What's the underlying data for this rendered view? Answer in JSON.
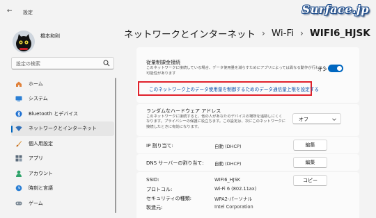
{
  "window": {
    "title": "設定",
    "back_icon": "back-arrow-icon"
  },
  "watermark": "Surface.jp",
  "user": {
    "name": "橋本和則"
  },
  "search": {
    "placeholder": "設定の検索"
  },
  "sidebar": {
    "items": [
      {
        "label": "ホーム",
        "icon": "home-icon",
        "selected": false
      },
      {
        "label": "システム",
        "icon": "monitor-icon",
        "selected": false
      },
      {
        "label": "Bluetooth とデバイス",
        "icon": "bluetooth-icon",
        "selected": false
      },
      {
        "label": "ネットワークとインターネット",
        "icon": "wifi-icon",
        "selected": true
      },
      {
        "label": "個人用設定",
        "icon": "brush-icon",
        "selected": false
      },
      {
        "label": "アプリ",
        "icon": "apps-icon",
        "selected": false
      },
      {
        "label": "アカウント",
        "icon": "person-icon",
        "selected": false
      },
      {
        "label": "時刻と言語",
        "icon": "globe-clock-icon",
        "selected": false
      },
      {
        "label": "ゲーム",
        "icon": "gamepad-icon",
        "selected": false
      }
    ]
  },
  "breadcrumb": {
    "items": [
      "ネットワークとインターネット",
      "Wi-Fi"
    ],
    "separator": "›",
    "current": "WIFI6_HJSK"
  },
  "metered": {
    "title": "従量制課金接続",
    "description": "このネットワークに接続している場合、データ使用量を減らすためにアプリによっては異なる動作が行われる可能性があります",
    "toggle_label": "オン",
    "toggle_on": true,
    "limit_link": "このネットワーク上のデータ使用量を制御するためのデータ通信量上限を設定する"
  },
  "random_hw": {
    "title": "ランダムなハードウェア アドレス",
    "description": "このネットワークに接続すると、他の人があなたのデバイスの場所を追跡しにくくなります。プライバシーの保護に役立ちます。この設定は、次にこのネットワークに接続したときに有効になります。",
    "dropdown_value": "オフ"
  },
  "ip": {
    "label": "IP 割り当て:",
    "value": "自動 (DHCP)",
    "button": "編集"
  },
  "dns": {
    "label": "DNS サーバーの割り当て:",
    "value": "自動 (DHCP)",
    "button": "編集"
  },
  "properties": {
    "copy_button": "コピー",
    "rows": [
      {
        "label": "SSID:",
        "value": "WIFI6_HJSK"
      },
      {
        "label": "プロトコル:",
        "value": "Wi-Fi 6 (802.11ax)"
      },
      {
        "label": "セキュリティの種類:",
        "value": "WPA2-パーソナル"
      },
      {
        "label": "製造元:",
        "value": "Intel Corporation"
      }
    ]
  },
  "colors": {
    "accent": "#0067c0",
    "highlight_border": "#e0202a"
  }
}
